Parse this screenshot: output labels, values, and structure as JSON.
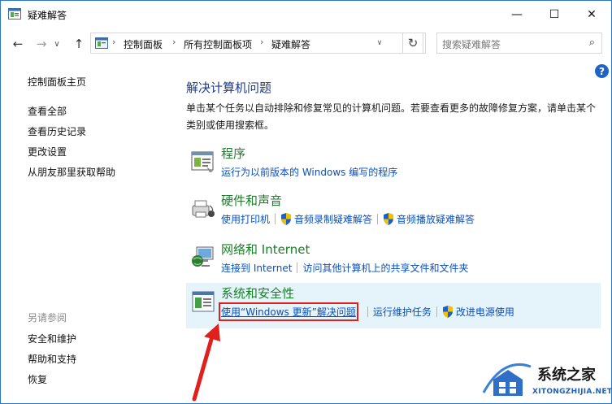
{
  "window": {
    "title": "疑难解答",
    "controls": {
      "minimize": "—",
      "maximize": "☐",
      "close": "✕"
    }
  },
  "nav": {
    "back": "←",
    "forward": "→",
    "recent": "∨",
    "up": "↑",
    "breadcrumbs": [
      "控制面板",
      "所有控制面板项",
      "疑难解答"
    ],
    "crumb_sep": "›",
    "dropdown": "∨",
    "refresh": "↻",
    "search_placeholder": "搜索疑难解答",
    "search_icon": "⌕"
  },
  "sidebar": {
    "home": "控制面板主页",
    "links": [
      "查看全部",
      "查看历史记录",
      "更改设置",
      "从朋友那里获取帮助"
    ],
    "see_also_title": "另请参阅",
    "see_also": [
      "安全和维护",
      "帮助和支持",
      "恢复"
    ]
  },
  "help_label": "?",
  "main": {
    "title": "解决计算机问题",
    "description": "单击某个任务以自动排除和修复常见的计算机问题。若要查看更多的故障修复方案，请单击某个类别或使用搜索框。",
    "categories": [
      {
        "title": "程序",
        "icon": "programs-icon",
        "links": [
          "运行为以前版本的 Windows 编写的程序"
        ]
      },
      {
        "title": "硬件和声音",
        "icon": "hardware-sound-icon",
        "links": [
          "使用打印机",
          "音频录制疑难解答",
          "音频播放疑难解答"
        ]
      },
      {
        "title": "网络和 Internet",
        "icon": "network-icon",
        "links": [
          "连接到 Internet",
          "访问其他计算机上的共享文件和文件夹"
        ]
      },
      {
        "title": "系统和安全性",
        "icon": "system-security-icon",
        "links": [
          "使用“Windows 更新”解决问题",
          "运行维护任务",
          "改进电源使用"
        ]
      }
    ]
  },
  "watermark": {
    "text": "系统之家",
    "sub": "XITONGZHIJIA.NET"
  },
  "colors": {
    "link": "#0b4fbf",
    "category_title": "#1a7f28",
    "heading": "#1e3a8a",
    "selected_bg": "#e5f3fb",
    "highlight": "#e0201c"
  }
}
